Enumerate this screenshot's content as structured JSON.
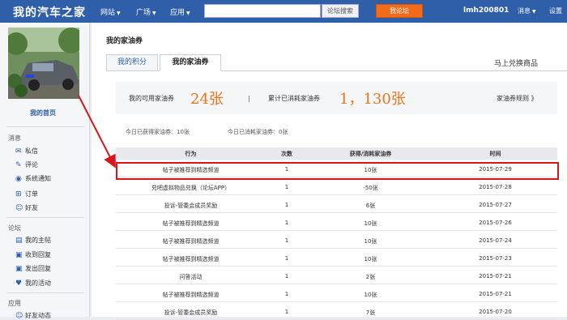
{
  "header": {
    "logo": "我的汽车之家",
    "nav": [
      "网站",
      "广场",
      "应用"
    ],
    "search_button": "论坛搜索",
    "post_button": "我论坛",
    "username": "lmh200801",
    "messages": "消息",
    "settings": "设置"
  },
  "sidebar": {
    "home": "我的首页",
    "sections": [
      {
        "title": "消息",
        "items": [
          {
            "icon": "mail-icon",
            "label": "私信"
          },
          {
            "icon": "edit-icon",
            "label": "评论"
          },
          {
            "icon": "notification-icon",
            "label": "系统通知"
          },
          {
            "icon": "cart-icon",
            "label": "订单"
          },
          {
            "icon": "friend-icon",
            "label": "好友"
          }
        ]
      },
      {
        "title": "论坛",
        "items": [
          {
            "icon": "post-icon",
            "label": "我的主帖"
          },
          {
            "icon": "reply-icon",
            "label": "收到回复"
          },
          {
            "icon": "send-reply-icon",
            "label": "发出回复"
          },
          {
            "icon": "heart-icon",
            "label": "我的活动"
          }
        ]
      },
      {
        "title": "应用",
        "items": [
          {
            "icon": "friend-activity-icon",
            "label": "好友动态"
          }
        ]
      }
    ]
  },
  "main": {
    "title": "我的家油券",
    "tabs": [
      "我的积分",
      "我的家油券"
    ],
    "redeem_link": "马上兑换商品",
    "summary": {
      "available_label": "我的可用家油券",
      "available_value": "24张",
      "divider": "|",
      "consumed_label": "累计已消耗家油券",
      "consumed_value": "1，130张",
      "rules_link": "家油券规则 》"
    },
    "today_earned": "今日已获得家油券：10张",
    "today_consumed": "今日已消耗家油券：0张",
    "table": {
      "headers": [
        "行为",
        "次数",
        "获得/消耗家油券",
        "时间"
      ],
      "rows": [
        [
          "帖子被推荐到精选频道",
          "1",
          "10张",
          "2015-07-29"
        ],
        [
          "兑吧虚拟物品兑换（论坛APP）",
          "1",
          "-50张",
          "2015-07-28"
        ],
        [
          "投诉-管委会成员奖励",
          "1",
          "6张",
          "2015-07-27"
        ],
        [
          "帖子被推荐到精选频道",
          "1",
          "10张",
          "2015-07-26"
        ],
        [
          "帖子被推荐到精选频道",
          "1",
          "10张",
          "2015-07-24"
        ],
        [
          "帖子被推荐到精选频道",
          "1",
          "10张",
          "2015-07-23"
        ],
        [
          "问答活动",
          "1",
          "2张",
          "2015-07-21"
        ],
        [
          "帖子被推荐到精选频道",
          "1",
          "10张",
          "2015-07-21"
        ],
        [
          "投诉-管委会成员奖励",
          "1",
          "7张",
          "2015-07-20"
        ]
      ]
    }
  },
  "colors": {
    "brand": "#2f5fa8",
    "accent": "#f26b1a",
    "highlight": "#d8141c",
    "value": "#e8751a"
  }
}
